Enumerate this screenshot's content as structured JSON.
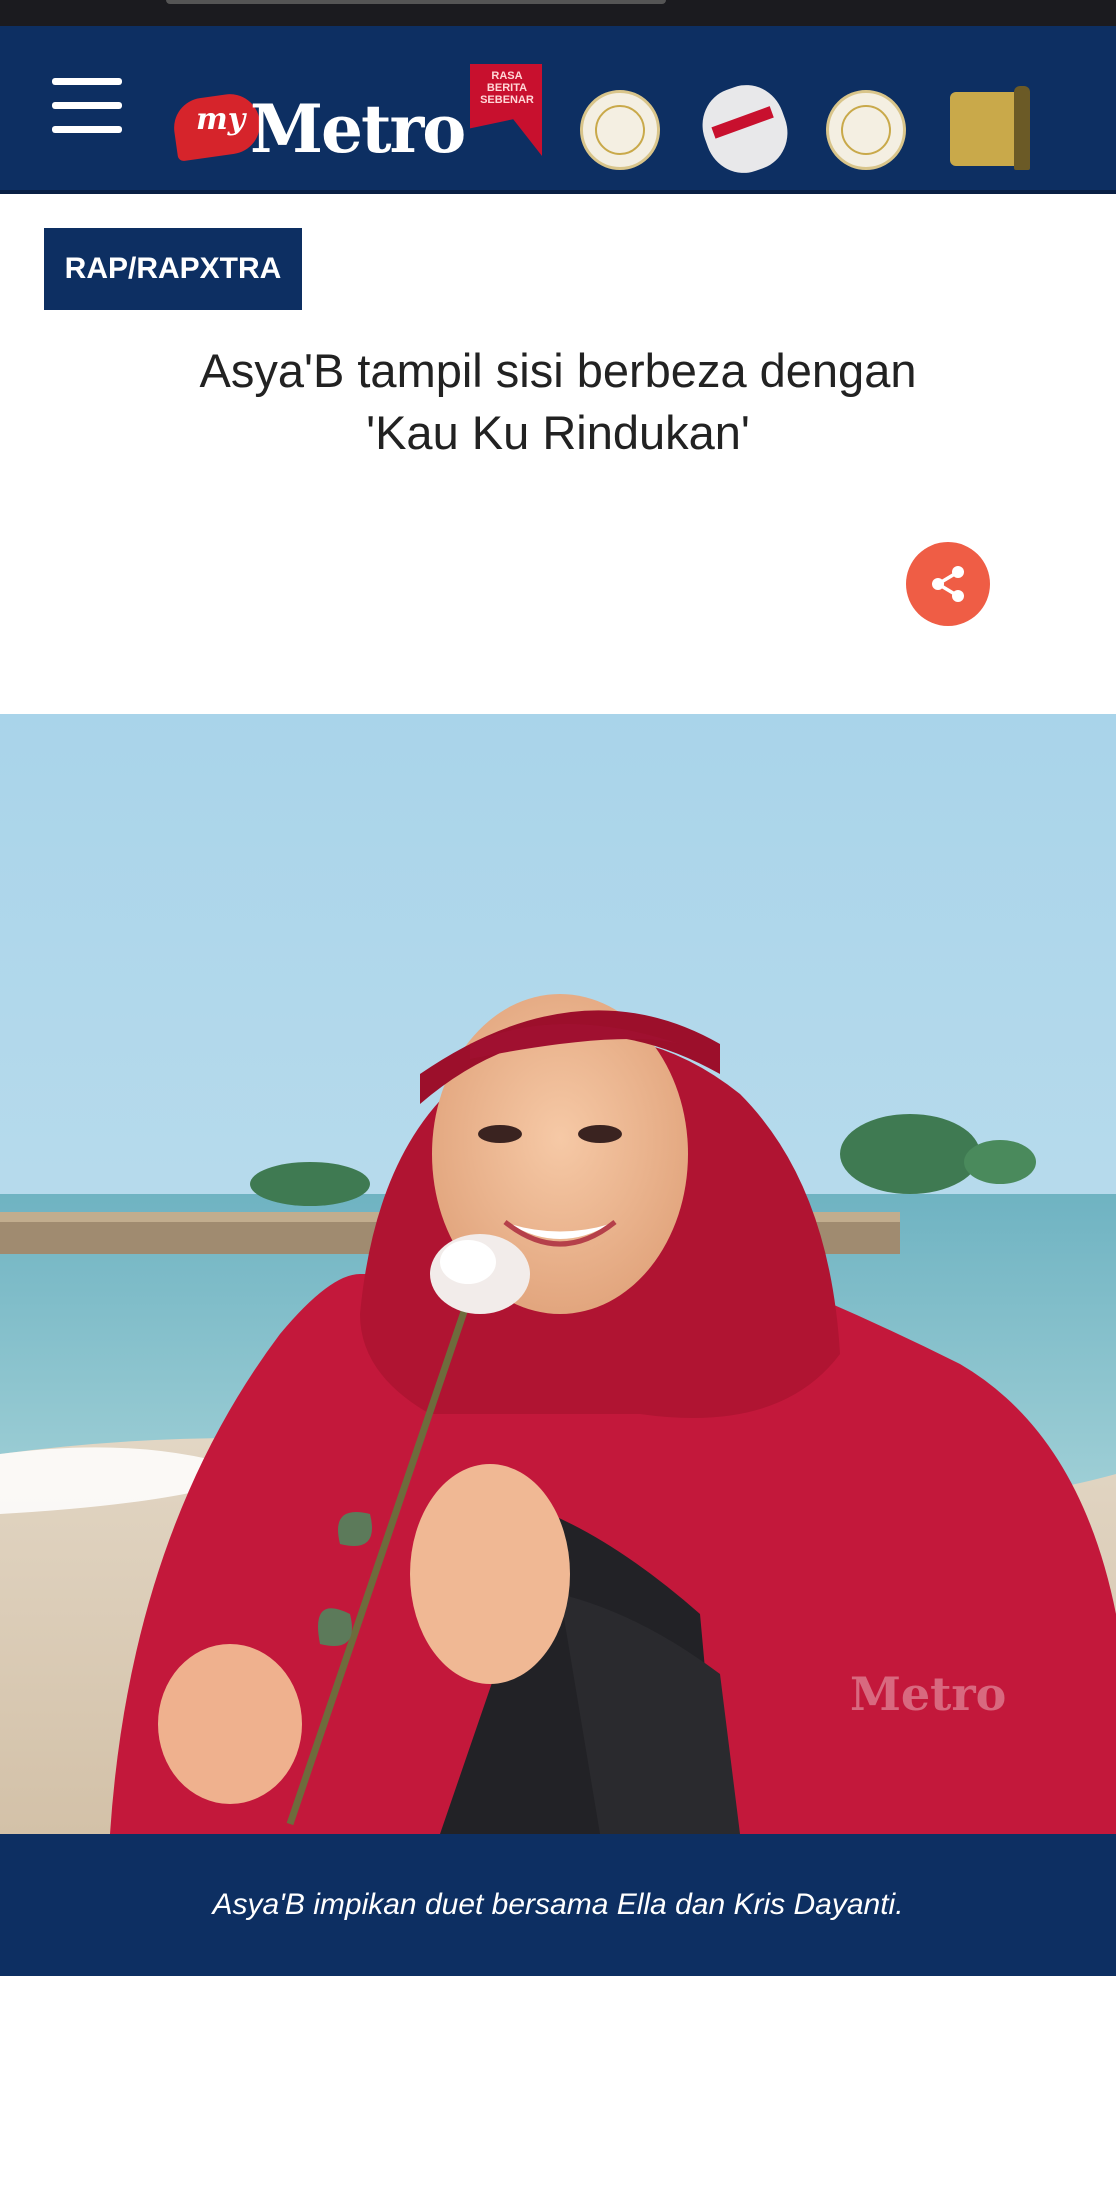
{
  "header": {
    "logo_prefix": "my",
    "logo_text": "Metro",
    "logo_tagline": "RASA BERITA SEBENAR",
    "awards": [
      "award-badge",
      "award-trophy",
      "award-medal",
      "award-plaque"
    ]
  },
  "article": {
    "category": "RAP/RAPXTRA",
    "headline_line1": "Asya'B tampil sisi berbeza dengan",
    "headline_line2": "'Kau Ku Rindukan'",
    "photo_watermark": "Metro",
    "caption": "Asya'B impikan duet bersama Ella dan Kris Dayanti."
  },
  "colors": {
    "brand_navy": "#0d2f62",
    "brand_red": "#d6242b",
    "share_orange": "#ef5d45"
  }
}
